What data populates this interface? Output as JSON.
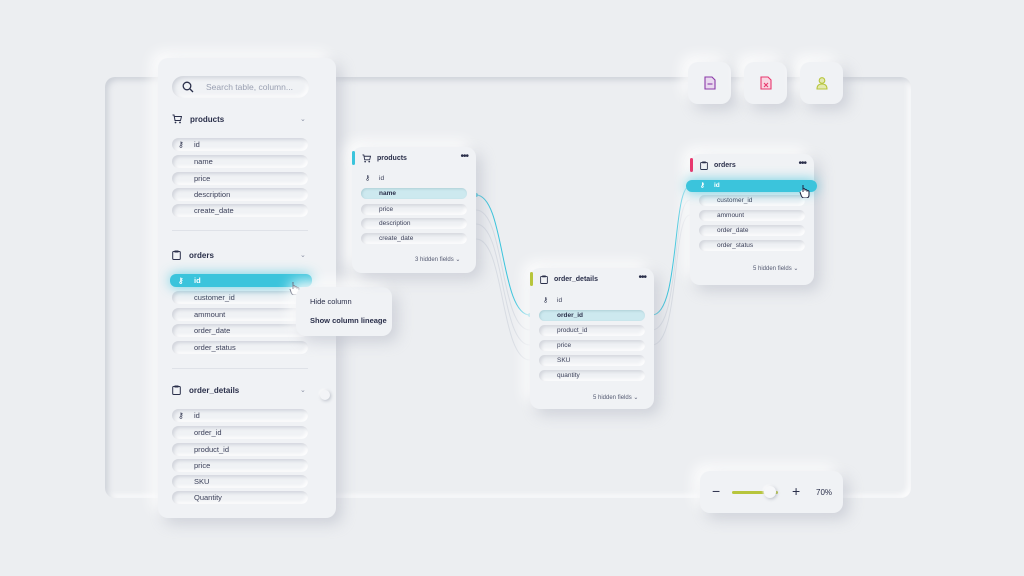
{
  "search": {
    "placeholder": "Search table, column..."
  },
  "sidebar": {
    "groups": [
      {
        "title": "products",
        "fields": [
          "id",
          "name",
          "price",
          "description",
          "create_date"
        ]
      },
      {
        "title": "orders",
        "fields": [
          "id",
          "customer_id",
          "ammount",
          "order_date",
          "order_status"
        ]
      },
      {
        "title": "order_details",
        "fields": [
          "id",
          "order_id",
          "product_id",
          "price",
          "SKU",
          "Quantity"
        ]
      }
    ]
  },
  "context_menu": {
    "hide": "Hide column",
    "lineage": "Show column lineage"
  },
  "cards": {
    "products": {
      "title": "products",
      "fields": [
        "id",
        "name",
        "price",
        "description",
        "create_date"
      ],
      "hidden": "3 hidden fields"
    },
    "order_details": {
      "title": "order_details",
      "fields": [
        "id",
        "order_id",
        "product_id",
        "price",
        "SKU",
        "quantity"
      ],
      "hidden": "5 hidden fields"
    },
    "orders": {
      "title": "orders",
      "fields": [
        "id",
        "customer_id",
        "ammount",
        "order_date",
        "order_status"
      ],
      "hidden": "5 hidden fields"
    }
  },
  "zoom": {
    "minus": "−",
    "plus": "+",
    "value": "70%",
    "level": 0.7
  },
  "colors": {
    "accent": "#3bc4dc",
    "products": "#3bc4dc",
    "order_details": "#b7c53c",
    "orders": "#e8386e"
  },
  "toolbar": {
    "icons": [
      "file-icon",
      "file-delete-icon",
      "user-icon"
    ]
  }
}
